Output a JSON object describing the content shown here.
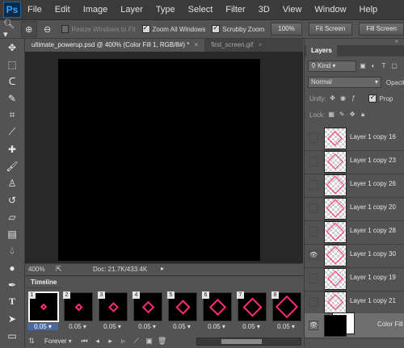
{
  "app": {
    "logo": "Ps"
  },
  "menu": [
    "File",
    "Edit",
    "Image",
    "Layer",
    "Type",
    "Select",
    "Filter",
    "3D",
    "View",
    "Window",
    "Help"
  ],
  "options": {
    "resize_windows": {
      "label": "Resize Windows to Fit",
      "checked": false
    },
    "zoom_all": {
      "label": "Zoom All Windows",
      "checked": true
    },
    "scrubby_zoom": {
      "label": "Scrubby Zoom",
      "checked": true
    },
    "btn_100": "100%",
    "btn_fit": "Fit Screen",
    "btn_fill": "Fill Screen"
  },
  "document": {
    "tabs": [
      {
        "label": "ultimate_powerup.psd @ 400% (Color Fill 1, RGB/8#) *",
        "active": true
      },
      {
        "label": "first_screen.gif",
        "active": false
      }
    ],
    "close_glyph": "×",
    "canvas_color": "#000000"
  },
  "status": {
    "zoom": "400%",
    "doc_info": "Doc: 21.7K/433.4K"
  },
  "timeline": {
    "title": "Timeline",
    "loop": "Forever",
    "frames": [
      {
        "num": "1",
        "delay": "0.05",
        "size": 0.05
      },
      {
        "num": "2",
        "delay": "0.05",
        "size": 0.12
      },
      {
        "num": "3",
        "delay": "0.05",
        "size": 0.22
      },
      {
        "num": "4",
        "delay": "0.05",
        "size": 0.3
      },
      {
        "num": "5",
        "delay": "0.05",
        "size": 0.38
      },
      {
        "num": "6",
        "delay": "0.05",
        "size": 0.48
      },
      {
        "num": "7",
        "delay": "0.05",
        "size": 0.55
      },
      {
        "num": "8",
        "delay": "0.05",
        "size": 0.68
      }
    ]
  },
  "layers_panel": {
    "tab": "Layers",
    "kind": "Kind",
    "blend": "Normal",
    "opacity_label": "Opacit",
    "unify_label": "Unify:",
    "prop_label": "Prop",
    "lock_label": "Lock:",
    "layers": [
      {
        "name": "Layer 1 copy 16",
        "visible": false,
        "selected": false,
        "size": 0.5
      },
      {
        "name": "Layer 1 copy 23",
        "visible": false,
        "selected": false,
        "size": 0.55
      },
      {
        "name": "Layer 1 copy 26",
        "visible": false,
        "selected": false,
        "size": 0.62
      },
      {
        "name": "Layer 1 copy 20",
        "visible": false,
        "selected": false,
        "size": 0.62
      },
      {
        "name": "Layer 1 copy 28",
        "visible": false,
        "selected": false,
        "size": 0.65
      },
      {
        "name": "Layer 1 copy 30",
        "visible": true,
        "selected": false,
        "size": 0.62
      },
      {
        "name": "Layer 1 copy 19",
        "visible": false,
        "selected": false,
        "size": 0.55
      },
      {
        "name": "Layer 1 copy 21",
        "visible": false,
        "selected": false,
        "size": 0.55
      },
      {
        "name": "Color Fill 1",
        "visible": true,
        "selected": true,
        "size": 0
      }
    ]
  },
  "colors": {
    "accent": "#ff2d6f",
    "selection": "#496aa0"
  }
}
